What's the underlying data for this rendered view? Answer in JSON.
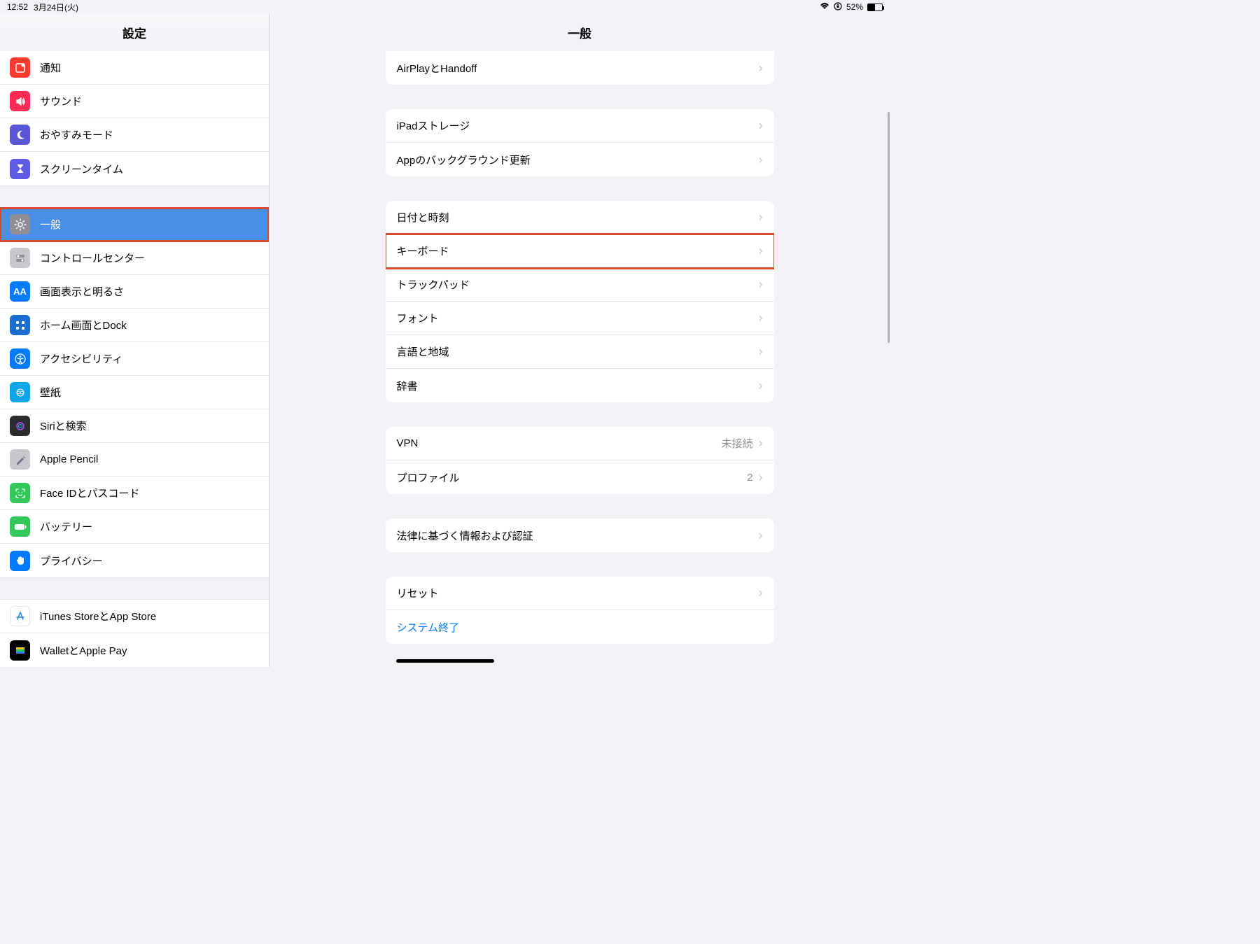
{
  "status": {
    "time": "12:52",
    "date": "3月24日(火)",
    "battery_pct": "52%"
  },
  "sidebar": {
    "title": "設定",
    "g1": {
      "notifications": "通知",
      "sound": "サウンド",
      "dnd": "おやすみモード",
      "screentime": "スクリーンタイム"
    },
    "g2": {
      "general": "一般",
      "control": "コントロールセンター",
      "display": "画面表示と明るさ",
      "home": "ホーム画面とDock",
      "accessibility": "アクセシビリティ",
      "wallpaper": "壁紙",
      "siri": "Siriと検索",
      "pencil": "Apple Pencil",
      "faceid": "Face IDとパスコード",
      "battery": "バッテリー",
      "privacy": "プライバシー"
    },
    "g3": {
      "itunes": "iTunes StoreとApp Store",
      "wallet": "WalletとApple Pay"
    }
  },
  "detail": {
    "title": "一般",
    "g1": {
      "airplay": "AirPlayとHandoff"
    },
    "g2": {
      "storage": "iPadストレージ",
      "bgrefresh": "Appのバックグラウンド更新"
    },
    "g3": {
      "datetime": "日付と時刻",
      "keyboard": "キーボード",
      "trackpad": "トラックパッド",
      "font": "フォント",
      "lang": "言語と地域",
      "dict": "辞書"
    },
    "g4": {
      "vpn": "VPN",
      "vpn_val": "未接続",
      "profile": "プロファイル",
      "profile_val": "2"
    },
    "g5": {
      "legal": "法律に基づく情報および認証"
    },
    "g6": {
      "reset": "リセット",
      "shutdown": "システム終了"
    }
  }
}
